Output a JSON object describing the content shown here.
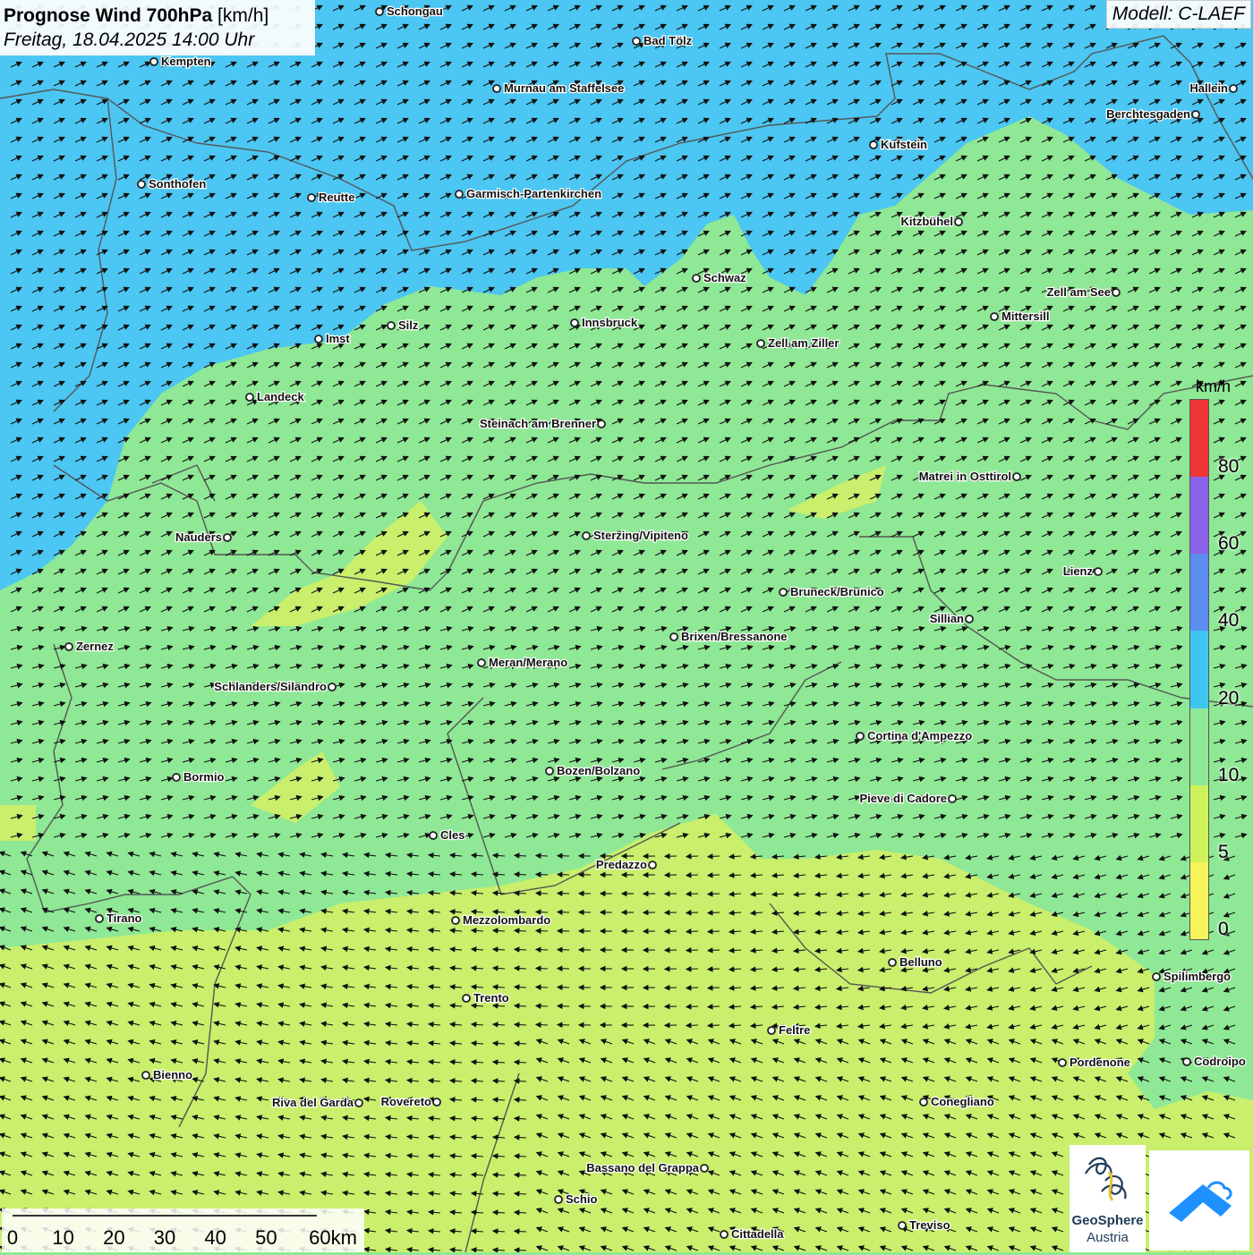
{
  "title": {
    "main": "Prognose Wind 700hPa",
    "unit": "[km/h]",
    "date": "Freitag, 18.04.2025 14:00 Uhr"
  },
  "model": "Modell: C-LAEF",
  "legend": {
    "unit": "km/h",
    "ticks": [
      "0",
      "5",
      "10",
      "20",
      "40",
      "60",
      "80"
    ],
    "colors": [
      "#f7f35a",
      "#cdf25a",
      "#8fe895",
      "#3fc6f0",
      "#5b8ef0",
      "#8a63e8",
      "#f03535"
    ]
  },
  "scalebar": {
    "labels": [
      "0",
      "10",
      "20",
      "30",
      "40",
      "50",
      "60km"
    ]
  },
  "logo": {
    "line1": "GeoSphere",
    "line2": "Austria"
  },
  "cities": [
    {
      "name": "Schongau"
    },
    {
      "name": "Bad Tölz"
    },
    {
      "name": "Kempten"
    },
    {
      "name": "Murnau am Staffelsee"
    },
    {
      "name": "Hallein"
    },
    {
      "name": "Berchtesgaden"
    },
    {
      "name": "Kufstein"
    },
    {
      "name": "Sonthofen"
    },
    {
      "name": "Reutte"
    },
    {
      "name": "Garmisch-Partenkirchen"
    },
    {
      "name": "Kitzbühel"
    },
    {
      "name": "Schwaz"
    },
    {
      "name": "Zell am See"
    },
    {
      "name": "Mittersill"
    },
    {
      "name": "Innsbruck"
    },
    {
      "name": "Silz"
    },
    {
      "name": "Imst"
    },
    {
      "name": "Zell am Ziller"
    },
    {
      "name": "Landeck"
    },
    {
      "name": "Steinach am Brenner"
    },
    {
      "name": "Matrei in Osttirol"
    },
    {
      "name": "Nauders"
    },
    {
      "name": "Sterzing/Vipiteno"
    },
    {
      "name": "Lienz"
    },
    {
      "name": "Bruneck/Brunico"
    },
    {
      "name": "Sillian"
    },
    {
      "name": "Zernez"
    },
    {
      "name": "Brixen/Bressanone"
    },
    {
      "name": "Meran/Merano"
    },
    {
      "name": "Schlanders/Silandro"
    },
    {
      "name": "Cortina d'Ampezzo"
    },
    {
      "name": "Bozen/Bolzano"
    },
    {
      "name": "Bormio"
    },
    {
      "name": "Pieve di Cadore"
    },
    {
      "name": "Cles"
    },
    {
      "name": "Predazzo"
    },
    {
      "name": "Tirano"
    },
    {
      "name": "Mezzolombardo"
    },
    {
      "name": "Belluno"
    },
    {
      "name": "Spilimbergo"
    },
    {
      "name": "Trento"
    },
    {
      "name": "Feltre"
    },
    {
      "name": "Bienno"
    },
    {
      "name": "Pordenone"
    },
    {
      "name": "Codroipo"
    },
    {
      "name": "Riva del Garda"
    },
    {
      "name": "Rovereto"
    },
    {
      "name": "Conegliano"
    },
    {
      "name": "Bassano del Grappa"
    },
    {
      "name": "Schio"
    },
    {
      "name": "Treviso"
    },
    {
      "name": "Cittadella"
    }
  ],
  "colors": {
    "north_zone": "#4cc6f2",
    "main_zone": "#8fe895",
    "south_zone": "#c5ef6f",
    "arrows": "#111111",
    "borders": "#555555"
  }
}
